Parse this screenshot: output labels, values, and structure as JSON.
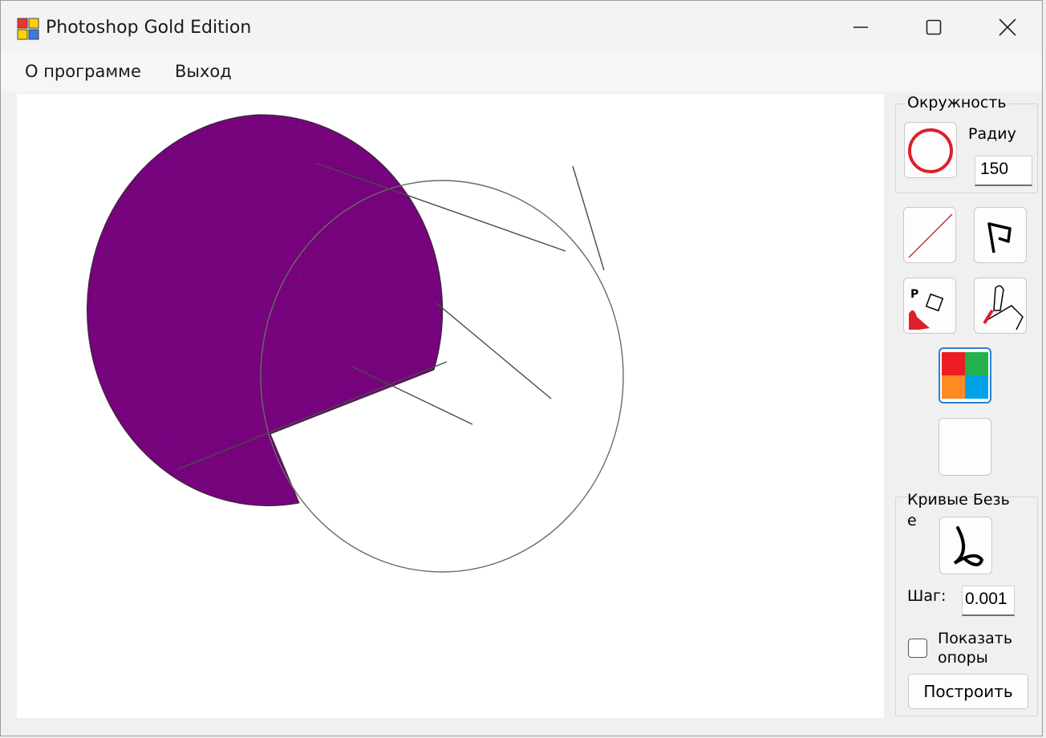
{
  "window": {
    "title": "Photoshop Gold Edition",
    "controls": [
      "minimize-icon",
      "maximize-icon",
      "close-icon"
    ]
  },
  "menu": {
    "items": [
      {
        "label": "О программе"
      },
      {
        "label": "Выход"
      }
    ]
  },
  "panel": {
    "circle_group": {
      "title": "Окружность",
      "radius_label": "Радиу",
      "radius_value": "150"
    },
    "tools": [
      {
        "icon": "line-tool-icon"
      },
      {
        "icon": "polyline-tool-icon"
      },
      {
        "icon": "fill-tool-icon"
      },
      {
        "icon": "brush-tool-icon"
      },
      {
        "icon": "color-palette-icon",
        "selected": true
      },
      {
        "icon": "secondary-color-swatch"
      }
    ],
    "bezier_group": {
      "title": "Кривые Безь\nе",
      "step_label": "Шаг:",
      "step_value": "0.001",
      "show_supports_label": "Показать опоры",
      "show_supports_checked": false,
      "build_label": "Построить"
    }
  },
  "colors": {
    "fill": "#800080",
    "stroke": "#555555",
    "accent_selected": "#2a7fd4"
  }
}
